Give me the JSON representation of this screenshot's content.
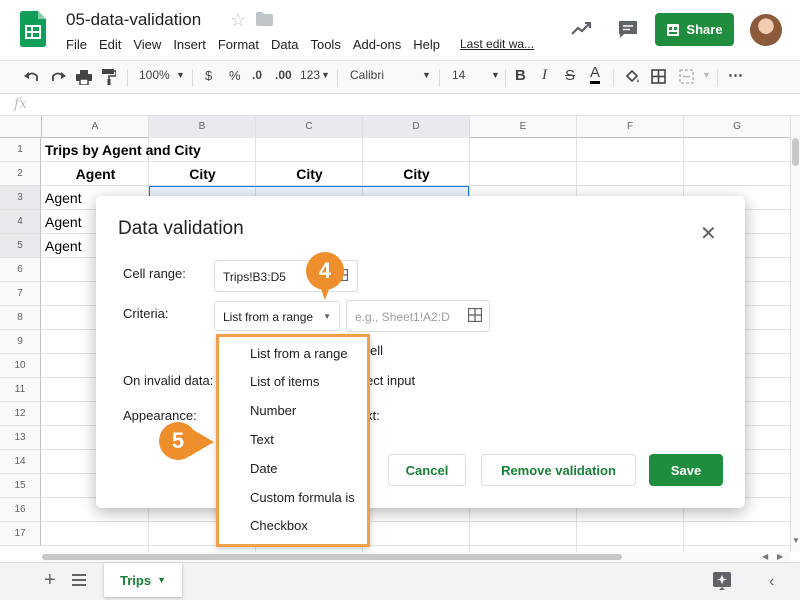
{
  "title_bar": {
    "doc_title": "05-data-validation",
    "menus": [
      "File",
      "Edit",
      "View",
      "Insert",
      "Format",
      "Data",
      "Tools",
      "Add-ons",
      "Help"
    ],
    "last_edit": "Last edit wa...",
    "share_label": "Share"
  },
  "toolbar": {
    "zoom": "100%",
    "currency": "$",
    "percent": "%",
    "decimal_decrease": ".0",
    "decimal_increase": ".00",
    "more_formats": "123",
    "font": "Calibri",
    "font_size": "14",
    "bold": "B",
    "italic": "I",
    "strike": "S",
    "text_color": "A",
    "more": "⋯"
  },
  "formula_bar": {
    "fx": "fx"
  },
  "grid": {
    "columns": [
      "A",
      "B",
      "C",
      "D",
      "E",
      "F",
      "G"
    ],
    "rows": [
      "1",
      "2",
      "3",
      "4",
      "5",
      "6",
      "7",
      "8",
      "9",
      "10",
      "11",
      "12",
      "13",
      "14",
      "15",
      "16",
      "17"
    ],
    "cells": {
      "a1": "Trips by Agent and City",
      "a2": "Agent",
      "b2": "City",
      "c2": "City",
      "d2": "City",
      "a3": "Agent",
      "a4": "Agent",
      "a5": "Agent"
    }
  },
  "dialog": {
    "title": "Data validation",
    "cell_range_label": "Cell range:",
    "cell_range_value": "Trips!B3:D5",
    "criteria_label": "Criteria:",
    "criteria_selected": "List from a range",
    "criteria_range_placeholder": "e.g., Sheet1!A2:D",
    "invalid_label": "On invalid data:",
    "appearance_label": "Appearance:",
    "partial_cell": "ell",
    "partial_reject": "ect input",
    "partial_text": "xt:",
    "cancel_label": "Cancel",
    "remove_label": "Remove validation",
    "save_label": "Save"
  },
  "criteria_menu": {
    "options": [
      "List from a range",
      "List of items",
      "Number",
      "Text",
      "Date",
      "Custom formula is",
      "Checkbox"
    ]
  },
  "callouts": {
    "step4": "4",
    "step5": "5"
  },
  "bottom_bar": {
    "sheet_name": "Trips"
  },
  "colors": {
    "accent_green": "#1e8e3e",
    "callout_orange": "#ef8e2d",
    "menu_highlight_border": "#f0a04b",
    "selection_blue": "#1a73e8"
  }
}
